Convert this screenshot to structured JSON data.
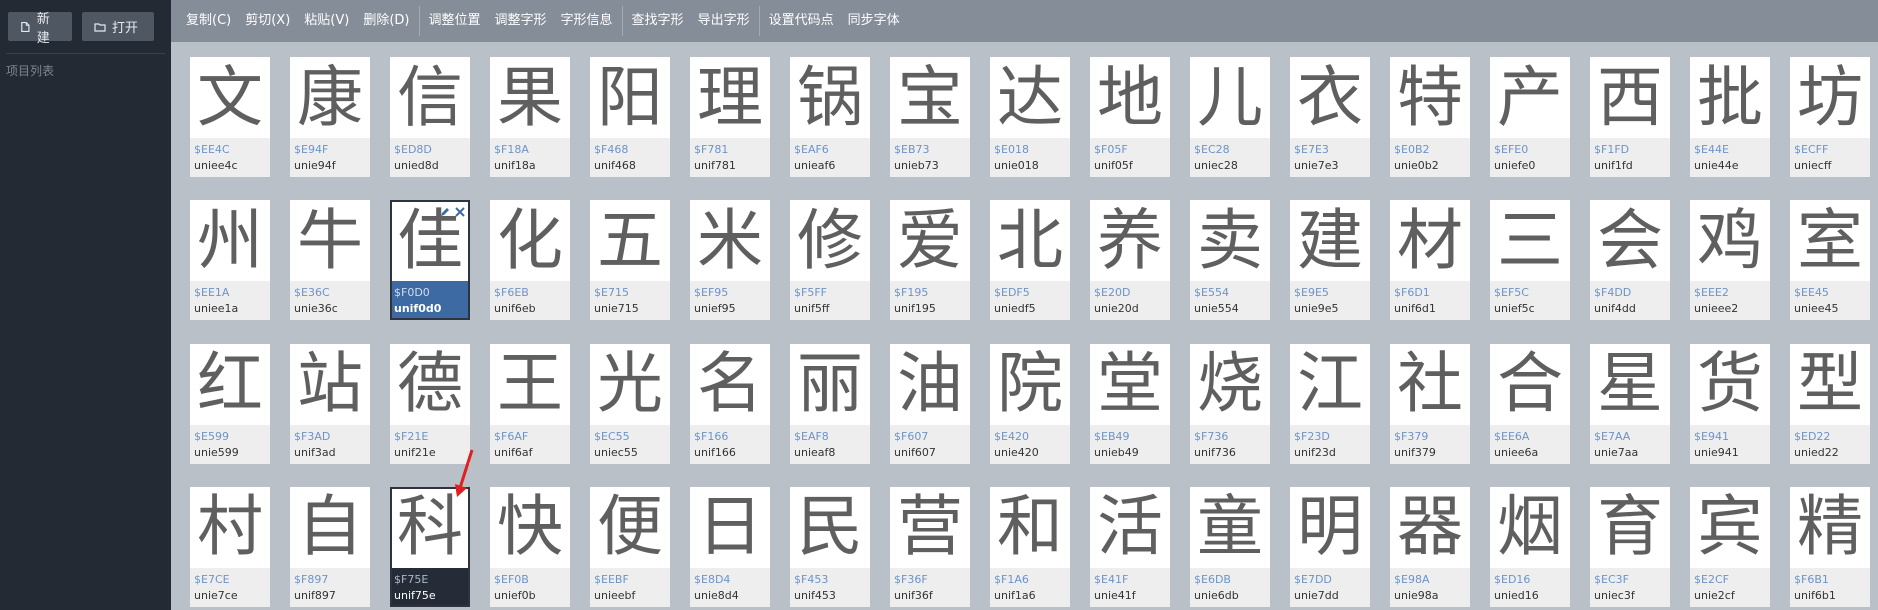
{
  "sidebar": {
    "new_label": "新建",
    "open_label": "打开",
    "list_title": "项目列表"
  },
  "toolbar": {
    "copy": "复制(C)",
    "cut": "剪切(X)",
    "paste": "粘贴(V)",
    "delete": "删除(D)",
    "adjust_position": "调整位置",
    "adjust_glyph": "调整字形",
    "glyph_info": "字形信息",
    "find_glyph": "查找字形",
    "export_glyph": "导出字形",
    "set_codepoint": "设置代码点",
    "sync_font": "同步字体"
  },
  "colors": {
    "sidebar_bg": "#242a33",
    "toolbar_bg": "#858d98",
    "grid_bg": "#b9c0c8",
    "code_text": "#6d93c8",
    "selected_blue": "#3e6aa3",
    "selected_dark": "#252c37",
    "arrow_red": "#e02020"
  },
  "glyphs": [
    {
      "char": "文",
      "code": "$EE4C",
      "name": "uniee4c"
    },
    {
      "char": "康",
      "code": "$E94F",
      "name": "unie94f"
    },
    {
      "char": "信",
      "code": "$ED8D",
      "name": "unied8d"
    },
    {
      "char": "果",
      "code": "$F18A",
      "name": "unif18a"
    },
    {
      "char": "阳",
      "code": "$F468",
      "name": "unif468"
    },
    {
      "char": "理",
      "code": "$F781",
      "name": "unif781"
    },
    {
      "char": "锅",
      "code": "$EAF6",
      "name": "unieaf6"
    },
    {
      "char": "宝",
      "code": "$EB73",
      "name": "unieb73"
    },
    {
      "char": "达",
      "code": "$E018",
      "name": "unie018"
    },
    {
      "char": "地",
      "code": "$F05F",
      "name": "unif05f"
    },
    {
      "char": "儿",
      "code": "$EC28",
      "name": "uniec28"
    },
    {
      "char": "衣",
      "code": "$E7E3",
      "name": "unie7e3"
    },
    {
      "char": "特",
      "code": "$E0B2",
      "name": "unie0b2"
    },
    {
      "char": "产",
      "code": "$EFE0",
      "name": "uniefe0"
    },
    {
      "char": "西",
      "code": "$F1FD",
      "name": "unif1fd"
    },
    {
      "char": "批",
      "code": "$E44E",
      "name": "unie44e"
    },
    {
      "char": "坊",
      "code": "$ECFF",
      "name": "uniecff"
    },
    {
      "char": "州",
      "code": "$EE1A",
      "name": "uniee1a"
    },
    {
      "char": "牛",
      "code": "$E36C",
      "name": "unie36c"
    },
    {
      "char": "佳",
      "code": "$F0D0",
      "name": "unif0d0",
      "state": "sel-blue"
    },
    {
      "char": "化",
      "code": "$F6EB",
      "name": "unif6eb"
    },
    {
      "char": "五",
      "code": "$E715",
      "name": "unie715"
    },
    {
      "char": "米",
      "code": "$EF95",
      "name": "unief95"
    },
    {
      "char": "修",
      "code": "$F5FF",
      "name": "unif5ff"
    },
    {
      "char": "爱",
      "code": "$F195",
      "name": "unif195"
    },
    {
      "char": "北",
      "code": "$EDF5",
      "name": "uniedf5"
    },
    {
      "char": "养",
      "code": "$E20D",
      "name": "unie20d"
    },
    {
      "char": "卖",
      "code": "$E554",
      "name": "unie554"
    },
    {
      "char": "建",
      "code": "$E9E5",
      "name": "unie9e5"
    },
    {
      "char": "材",
      "code": "$F6D1",
      "name": "unif6d1"
    },
    {
      "char": "三",
      "code": "$EF5C",
      "name": "unief5c"
    },
    {
      "char": "会",
      "code": "$F4DD",
      "name": "unif4dd"
    },
    {
      "char": "鸡",
      "code": "$EEE2",
      "name": "unieee2"
    },
    {
      "char": "室",
      "code": "$EE45",
      "name": "uniee45"
    },
    {
      "char": "红",
      "code": "$E599",
      "name": "unie599"
    },
    {
      "char": "站",
      "code": "$F3AD",
      "name": "unif3ad"
    },
    {
      "char": "德",
      "code": "$F21E",
      "name": "unif21e"
    },
    {
      "char": "王",
      "code": "$F6AF",
      "name": "unif6af"
    },
    {
      "char": "光",
      "code": "$EC55",
      "name": "uniec55"
    },
    {
      "char": "名",
      "code": "$F166",
      "name": "unif166"
    },
    {
      "char": "丽",
      "code": "$EAF8",
      "name": "unieaf8"
    },
    {
      "char": "油",
      "code": "$F607",
      "name": "unif607"
    },
    {
      "char": "院",
      "code": "$E420",
      "name": "unie420"
    },
    {
      "char": "堂",
      "code": "$EB49",
      "name": "unieb49"
    },
    {
      "char": "烧",
      "code": "$F736",
      "name": "unif736"
    },
    {
      "char": "江",
      "code": "$F23D",
      "name": "unif23d"
    },
    {
      "char": "社",
      "code": "$F379",
      "name": "unif379"
    },
    {
      "char": "合",
      "code": "$EE6A",
      "name": "uniee6a"
    },
    {
      "char": "星",
      "code": "$E7AA",
      "name": "unie7aa"
    },
    {
      "char": "货",
      "code": "$E941",
      "name": "unie941"
    },
    {
      "char": "型",
      "code": "$ED22",
      "name": "unied22"
    },
    {
      "char": "村",
      "code": "$E7CE",
      "name": "unie7ce"
    },
    {
      "char": "自",
      "code": "$F897",
      "name": "unif897"
    },
    {
      "char": "科",
      "code": "$F75E",
      "name": "unif75e",
      "state": "sel-dark"
    },
    {
      "char": "快",
      "code": "$EF0B",
      "name": "unief0b"
    },
    {
      "char": "便",
      "code": "$EEBF",
      "name": "unieebf"
    },
    {
      "char": "日",
      "code": "$E8D4",
      "name": "unie8d4"
    },
    {
      "char": "民",
      "code": "$F453",
      "name": "unif453"
    },
    {
      "char": "营",
      "code": "$F36F",
      "name": "unif36f"
    },
    {
      "char": "和",
      "code": "$F1A6",
      "name": "unif1a6"
    },
    {
      "char": "活",
      "code": "$E41F",
      "name": "unie41f"
    },
    {
      "char": "童",
      "code": "$E6DB",
      "name": "unie6db"
    },
    {
      "char": "明",
      "code": "$E7DD",
      "name": "unie7dd"
    },
    {
      "char": "器",
      "code": "$E98A",
      "name": "unie98a"
    },
    {
      "char": "烟",
      "code": "$ED16",
      "name": "unied16"
    },
    {
      "char": "育",
      "code": "$EC3F",
      "name": "uniec3f"
    },
    {
      "char": "宾",
      "code": "$E2CF",
      "name": "unie2cf"
    },
    {
      "char": "精",
      "code": "$F6B1",
      "name": "unif6b1"
    }
  ]
}
